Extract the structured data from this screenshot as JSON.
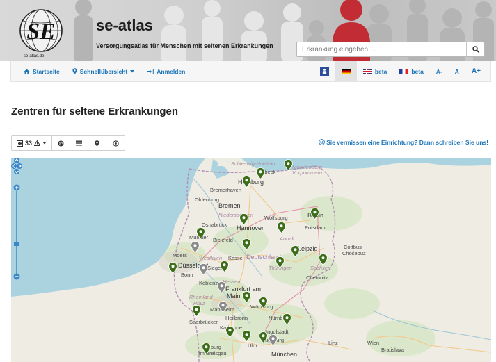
{
  "brand": {
    "title": "se-atlas",
    "subtitle": "Versorgungsatlas für Menschen mit seltenen Erkrankungen",
    "logo_text": "SE",
    "logo_url_text": "se-atlas.de"
  },
  "search": {
    "placeholder": "Erkrankung eingeben ...",
    "icon": "search-icon"
  },
  "nav": {
    "home": "Startseite",
    "overview": "Schnellübersicht",
    "login": "Anmelden",
    "lang_en": "beta",
    "lang_fr": "beta",
    "font_small": "A-",
    "font_normal": "A",
    "font_large": "A+"
  },
  "page": {
    "title": "Zentren für seltene Erkrankungen"
  },
  "toolbar": {
    "count": "33"
  },
  "missing": {
    "text": "Sie vermissen eine Einrichtung? Dann schreiben Sie uns!"
  },
  "map": {
    "labels": {
      "schleswig": "Schleswig-Holstein",
      "hamburg": "Hamburg",
      "luebeck": "Lübeck",
      "mecklenburg": "Mecklenburg-Vorpommern",
      "bremerhaven": "Bremerhaven",
      "oldenburg": "Oldenburg",
      "bremen": "Bremen",
      "niedersachsen": "Niedersachsen",
      "wolfsburg": "Wolfsburg",
      "berlin": "Berlin",
      "osnabrueck": "Osnabrück",
      "hannover": "Hannover",
      "potsdam": "Potsdam",
      "muenster": "Münster",
      "bielefeld": "Bielefeld",
      "anhalt": "Anhalt",
      "cottbus": "Cottbus",
      "chosebuz": "Chóśebuz",
      "moers": "Moers",
      "nrw": "Westfalen",
      "kassel": "Kassel",
      "deutschland": "Deutschland",
      "leipzig": "Leipzig",
      "duesseldorf": "Düsseldorf",
      "siegen": "Siegen",
      "thueringen": "Thüringen",
      "sachsen": "Sachsen",
      "koblenz": "Koblenz",
      "chemnitz": "Chemnitz",
      "hessen": "Hessen",
      "frankfurt": "Frankfurt am",
      "main": "Main",
      "rheinland": "Rheinland-",
      "pfalz": "Pfalz",
      "wuerzburg": "Würzburg",
      "mannheim": "Mannheim",
      "heilbronn": "Heilbronn",
      "nuernberg": "Nürnberg",
      "saarbruecken": "Saarbrücken",
      "karlsruhe": "Karlsruhe",
      "ingolstadt": "Ingolstadt",
      "augsburg": "Augsburg",
      "ulm": "Ulm",
      "linz": "Linz",
      "wien": "Wien",
      "bratislava": "Bratislava",
      "freiburg": "Freiburg",
      "imbreisgau": "im Breisgau",
      "muenchen": "München",
      "bonn": "Bonn"
    }
  },
  "colors": {
    "marker_green": "#3c6e1a",
    "marker_gray": "#8a8a8a",
    "link_blue": "#1a73b8",
    "sea": "#aad3df",
    "land": "#efece4"
  }
}
